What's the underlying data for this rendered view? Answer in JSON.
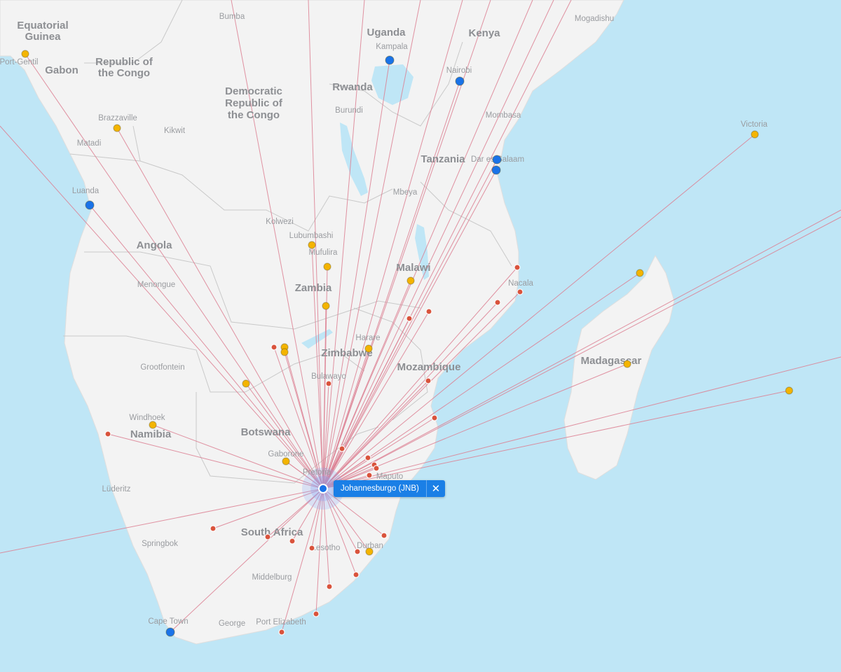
{
  "popup": {
    "label": "Johannesburgo (JNB)",
    "close_glyph": "✕"
  },
  "colors": {
    "water": "#bfe6f6",
    "land": "#f3f3f3",
    "border": "#c9c9c9",
    "route": "#dc7f92",
    "blue_dot": "#1a73e8",
    "yellow_dot": "#f4b400",
    "red_dot": "#d9533c"
  },
  "country_labels": [
    "Equatorial",
    "Guinea",
    "Gabon",
    "Republic of",
    "the Congo",
    "Democratic",
    "Republic of",
    "the Congo",
    "Uganda",
    "Kenya",
    "Rwanda",
    "Tanzania",
    "Angola",
    "Zambia",
    "Malawi",
    "Zimbabwe",
    "Mozambique",
    "Madagascar",
    "Namibia",
    "Botswana",
    "South Africa"
  ],
  "city_labels": [
    "Bumba",
    "Kampala",
    "Nairobi",
    "Mogadishu",
    "Burundi",
    "Mombasa",
    "Brazzaville",
    "Kikwit",
    "Matadi",
    "Dar es Salaam",
    "Victoria",
    "Luanda",
    "Mbeya",
    "Kolwezi",
    "Lubumbashi",
    "Mufulira",
    "Menongue",
    "Nacala",
    "Grootfontein",
    "Harare",
    "Bulawayo",
    "Windhoek",
    "Gaborone",
    "Pretoria",
    "Lüderitz",
    "Maputo",
    "Springbok",
    "Lesotho",
    "Durban",
    "Middelburg",
    "Cape Town",
    "George",
    "Port Elizabeth",
    "Port-Gentil"
  ],
  "hub": {
    "name": "Johannesburgo (JNB)"
  },
  "destinations": [
    {
      "type": "yellow"
    },
    {
      "type": "blue"
    },
    {
      "type": "blue"
    },
    {
      "type": "yellow"
    },
    {
      "type": "blue"
    },
    {
      "type": "blue"
    },
    {
      "type": "blue"
    },
    {
      "type": "yellow"
    },
    {
      "type": "yellow"
    },
    {
      "type": "yellow"
    },
    {
      "type": "yellow"
    },
    {
      "type": "yellow"
    },
    {
      "type": "yellow"
    },
    {
      "type": "yellow"
    },
    {
      "type": "yellow"
    },
    {
      "type": "yellow"
    },
    {
      "type": "yellow"
    },
    {
      "type": "yellow"
    },
    {
      "type": "yellow"
    },
    {
      "type": "yellow"
    },
    {
      "type": "blue"
    },
    {
      "type": "red"
    },
    {
      "type": "red"
    },
    {
      "type": "red"
    },
    {
      "type": "red"
    },
    {
      "type": "red"
    },
    {
      "type": "red"
    },
    {
      "type": "red"
    },
    {
      "type": "red"
    },
    {
      "type": "red"
    },
    {
      "type": "red"
    },
    {
      "type": "red"
    },
    {
      "type": "red"
    },
    {
      "type": "red"
    },
    {
      "type": "red"
    },
    {
      "type": "red"
    },
    {
      "type": "red"
    },
    {
      "type": "red"
    },
    {
      "type": "red"
    },
    {
      "type": "red"
    },
    {
      "type": "red"
    },
    {
      "type": "red"
    },
    {
      "type": "red"
    },
    {
      "type": "red"
    },
    {
      "type": "red"
    },
    {
      "type": "red"
    },
    {
      "type": "red"
    }
  ]
}
